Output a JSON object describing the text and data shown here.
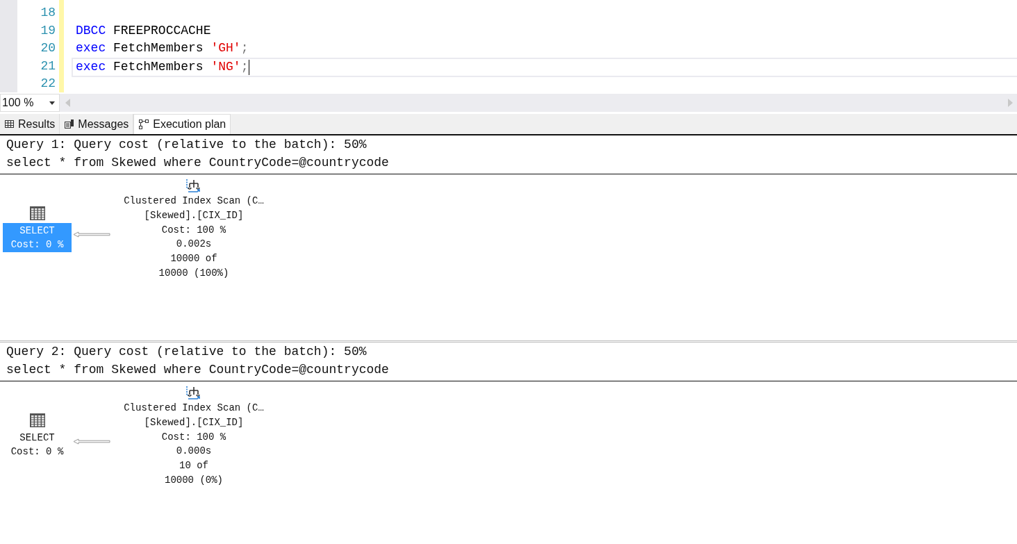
{
  "editor": {
    "lines": [
      {
        "number": "18",
        "current": false
      },
      {
        "number": "19",
        "current": false,
        "tokens": [
          {
            "kind": "keyword",
            "text": "DBCC"
          },
          {
            "kind": "plain",
            "text": " FREEPROCCACHE"
          }
        ]
      },
      {
        "number": "20",
        "current": false,
        "tokens": [
          {
            "kind": "keyword",
            "text": "exec"
          },
          {
            "kind": "plain",
            "text": " FetchMembers "
          },
          {
            "kind": "string",
            "text": "'GH'"
          },
          {
            "kind": "punct",
            "text": ";"
          }
        ]
      },
      {
        "number": "21",
        "current": true,
        "tokens": [
          {
            "kind": "keyword",
            "text": "exec"
          },
          {
            "kind": "plain",
            "text": " FetchMembers "
          },
          {
            "kind": "string",
            "text": "'NG'"
          },
          {
            "kind": "punct",
            "text": ";"
          }
        ]
      },
      {
        "number": "22",
        "current": false
      }
    ]
  },
  "zoom": {
    "value": "100 %"
  },
  "tabs": [
    {
      "label": "Results",
      "kind": "grid",
      "selected": false
    },
    {
      "label": "Messages",
      "kind": "messages",
      "selected": false
    },
    {
      "label": "Execution plan",
      "kind": "plan",
      "selected": true
    }
  ],
  "queries": [
    {
      "header": "Query 1: Query cost (relative to the batch): 50%",
      "sql": "select * from Skewed where CountryCode=@countrycode",
      "select_node": {
        "label": "SELECT",
        "cost": "Cost: 0 %",
        "selected": true
      },
      "scan_node": {
        "lines": [
          "Clustered Index Scan (C…",
          "[Skewed].[CIX_ID]",
          "Cost: 100 %",
          "0.002s",
          "10000 of",
          "10000 (100%)"
        ]
      }
    },
    {
      "header": "Query 2: Query cost (relative to the batch): 50%",
      "sql": "select * from Skewed where CountryCode=@countrycode",
      "select_node": {
        "label": "SELECT",
        "cost": "Cost: 0 %",
        "selected": false
      },
      "scan_node": {
        "lines": [
          "Clustered Index Scan (C…",
          "[Skewed].[CIX_ID]",
          "Cost: 100 %",
          "0.000s",
          "10 of",
          "10000 (0%)"
        ]
      }
    }
  ]
}
